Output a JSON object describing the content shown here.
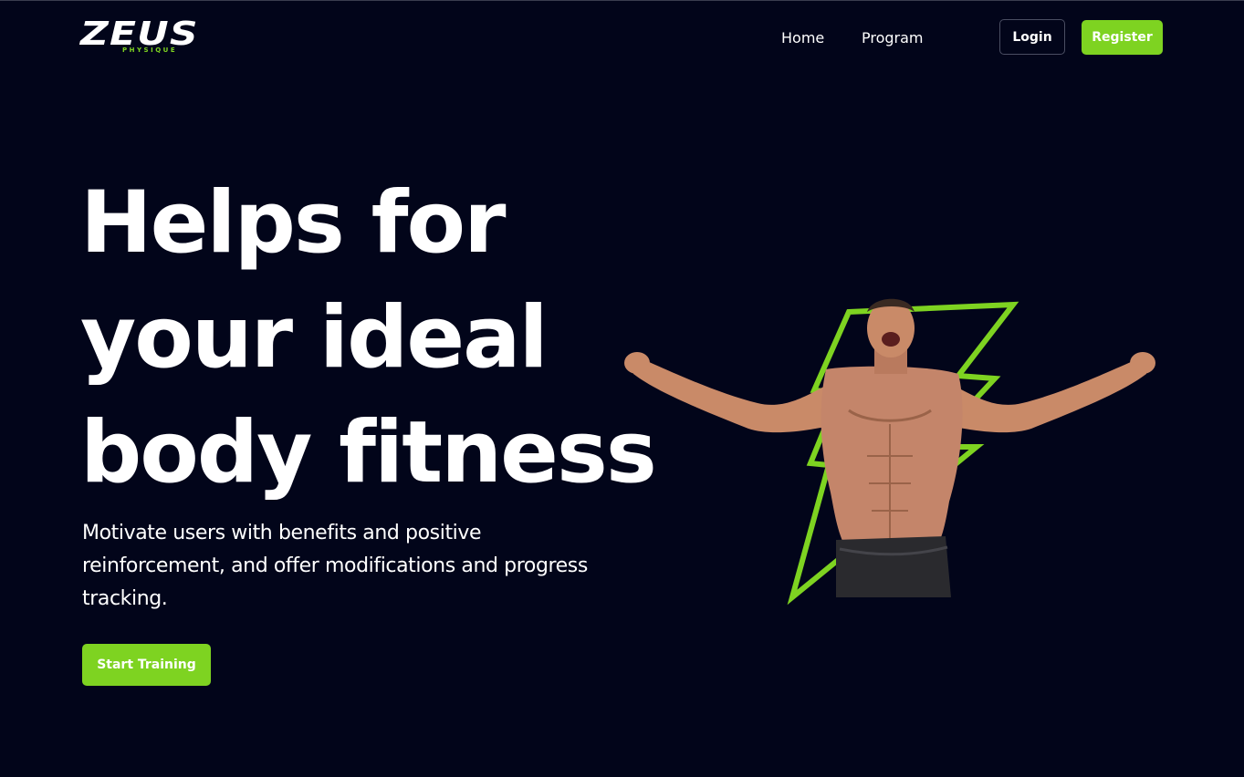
{
  "header": {
    "logo_text": "ZEUS",
    "logo_subtext": "PHYSIQUE",
    "nav": [
      {
        "label": "Home"
      },
      {
        "label": "Program"
      }
    ],
    "login_label": "Login",
    "register_label": "Register"
  },
  "hero": {
    "title_lines": [
      "Helps for",
      "your ideal",
      "body fitness"
    ],
    "subtitle": "Motivate users with benefits and positive reinforcement, and offer modifications and progress tracking.",
    "cta_label": "Start Training",
    "image_icon": "muscular-man-lightning-bolt-illustration"
  },
  "colors": {
    "background": "#02051a",
    "accent": "#7ed321",
    "text": "#ffffff",
    "skin": "#c98a68"
  }
}
